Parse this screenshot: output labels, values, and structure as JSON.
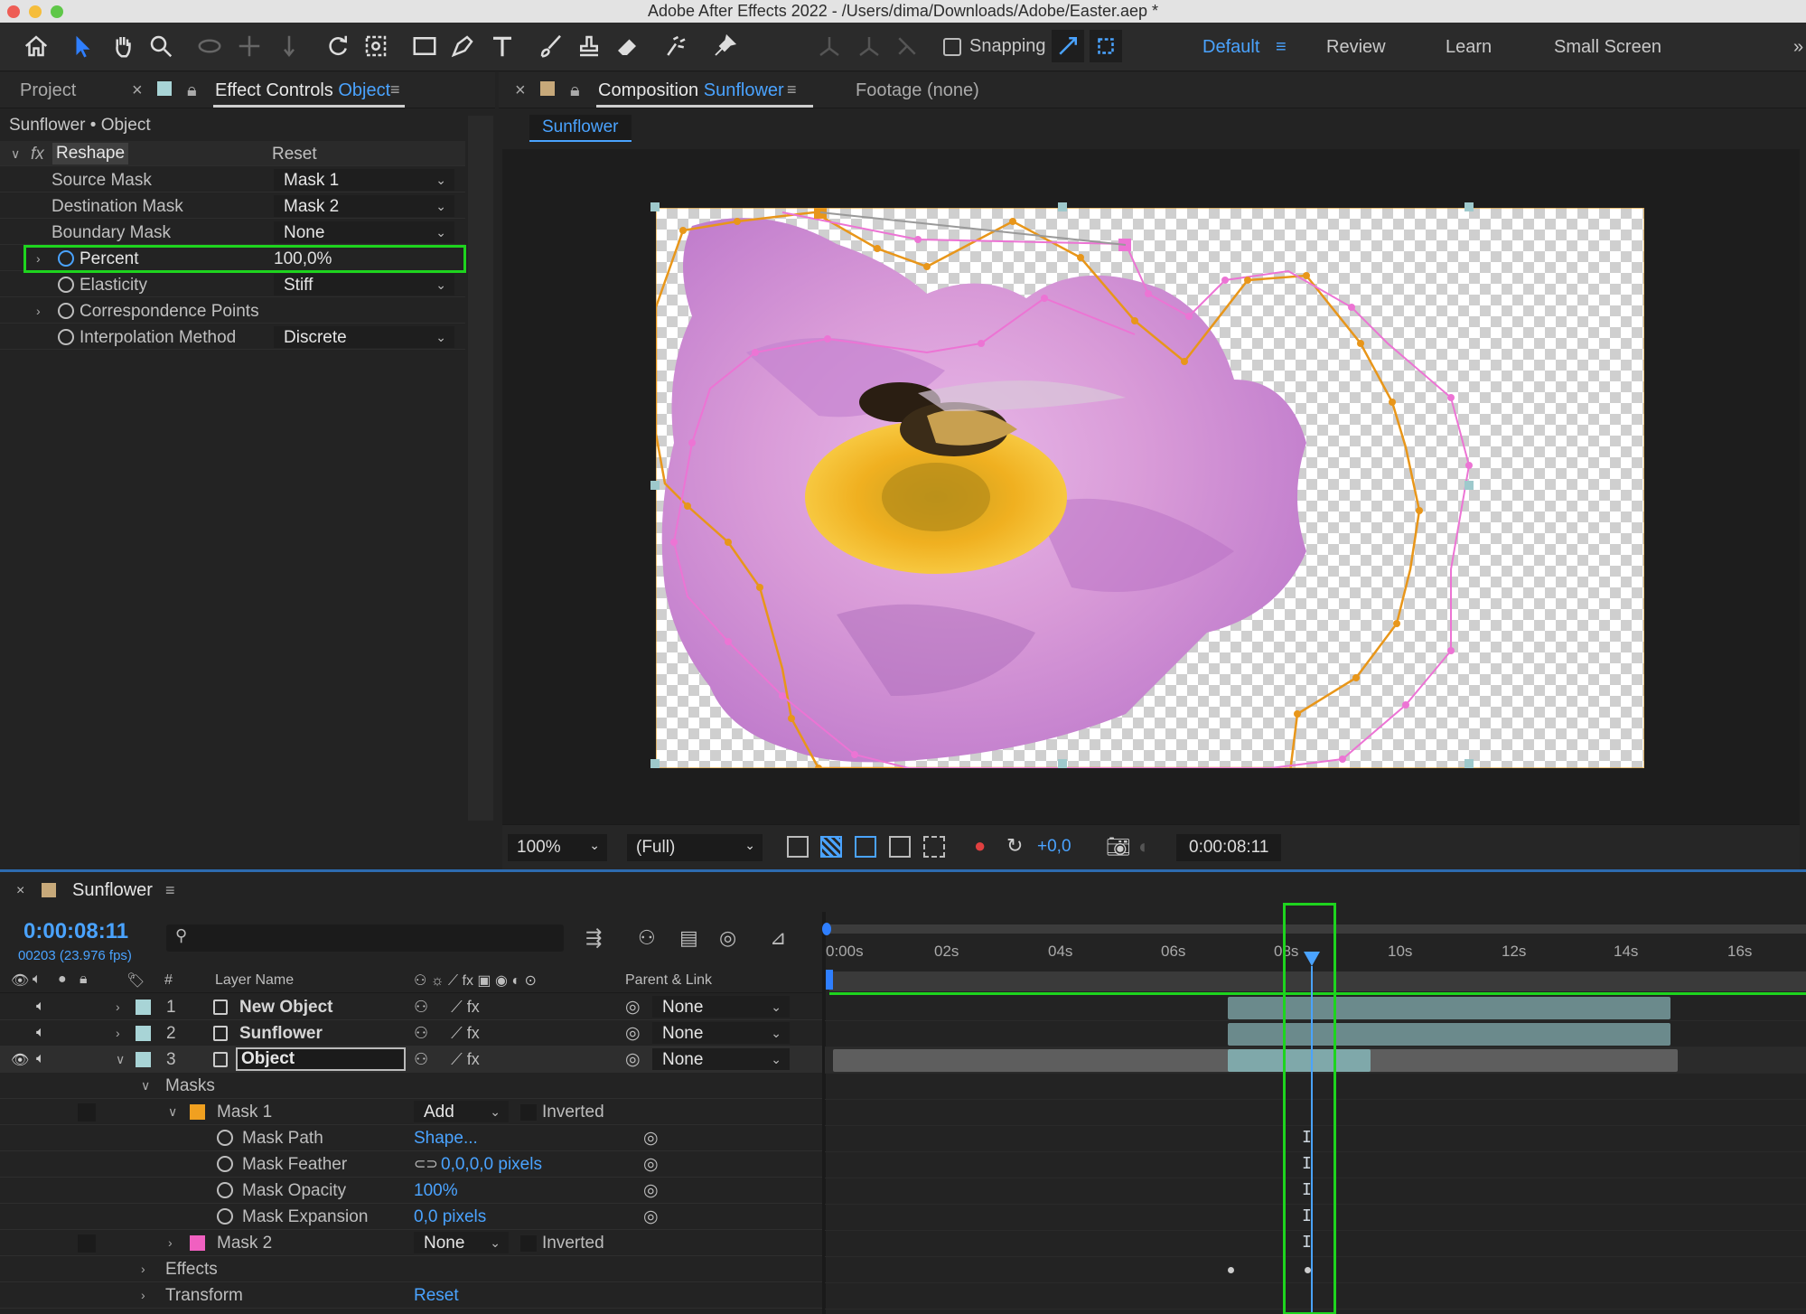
{
  "app": {
    "title": "Adobe After Effects 2022 - /Users/dima/Downloads/Adobe/Easter.aep *"
  },
  "toolbar": {
    "snapping_label": "Snapping",
    "workspaces": [
      "Default",
      "Review",
      "Learn",
      "Small Screen"
    ],
    "active_workspace": "Default"
  },
  "left_panel": {
    "tabs": {
      "project": "Project",
      "effect_controls": "Effect Controls",
      "effect_controls_target": "Object"
    },
    "layer_path": "Sunflower • Object",
    "effect": {
      "name": "Reshape",
      "reset": "Reset",
      "fx": "fx"
    },
    "properties": [
      {
        "label": "Source Mask",
        "value": "Mask 1"
      },
      {
        "label": "Destination Mask",
        "value": "Mask 2"
      },
      {
        "label": "Boundary Mask",
        "value": "None"
      },
      {
        "label": "Percent",
        "value": "100,0%"
      },
      {
        "label": "Elasticity",
        "value": "Stiff"
      },
      {
        "label": "Correspondence Points",
        "value": ""
      },
      {
        "label": "Interpolation Method",
        "value": "Discrete"
      }
    ]
  },
  "composition": {
    "tab_prefix": "Composition",
    "tab_name": "Sunflower",
    "footage_tab": "Footage (none)",
    "breadcrumb": "Sunflower",
    "zoom": "100%",
    "resolution": "(Full)",
    "exposure": "+0,0",
    "timecode": "0:00:08:11"
  },
  "timeline": {
    "comp_name": "Sunflower",
    "current_time": "0:00:08:11",
    "frame_info": "00203 (23.976 fps)",
    "headers": {
      "num": "#",
      "layer_name": "Layer Name",
      "parent": "Parent & Link"
    },
    "ruler": [
      "0:00s",
      "02s",
      "04s",
      "06s",
      "08s",
      "10s",
      "12s",
      "14s",
      "16s"
    ],
    "layers": [
      {
        "num": "1",
        "name": "New Object",
        "parent": "None",
        "color": "#a8d4d6"
      },
      {
        "num": "2",
        "name": "Sunflower",
        "parent": "None",
        "color": "#a8d4d6"
      },
      {
        "num": "3",
        "name": "Object",
        "parent": "None",
        "color": "#a8d4d6"
      }
    ],
    "masks_group": "Masks",
    "mask1": {
      "name": "Mask 1",
      "mode": "Add",
      "inverted": "Inverted",
      "color": "#f0a020"
    },
    "mask1_props": [
      {
        "label": "Mask Path",
        "value": "Shape..."
      },
      {
        "label": "Mask Feather",
        "value": "0,0,0,0 pixels"
      },
      {
        "label": "Mask Opacity",
        "value": "100%"
      },
      {
        "label": "Mask Expansion",
        "value": "0,0 pixels"
      }
    ],
    "mask2": {
      "name": "Mask 2",
      "mode": "None",
      "inverted": "Inverted",
      "color": "#f060c0"
    },
    "effects": "Effects",
    "transform": "Transform",
    "transform_reset": "Reset"
  }
}
